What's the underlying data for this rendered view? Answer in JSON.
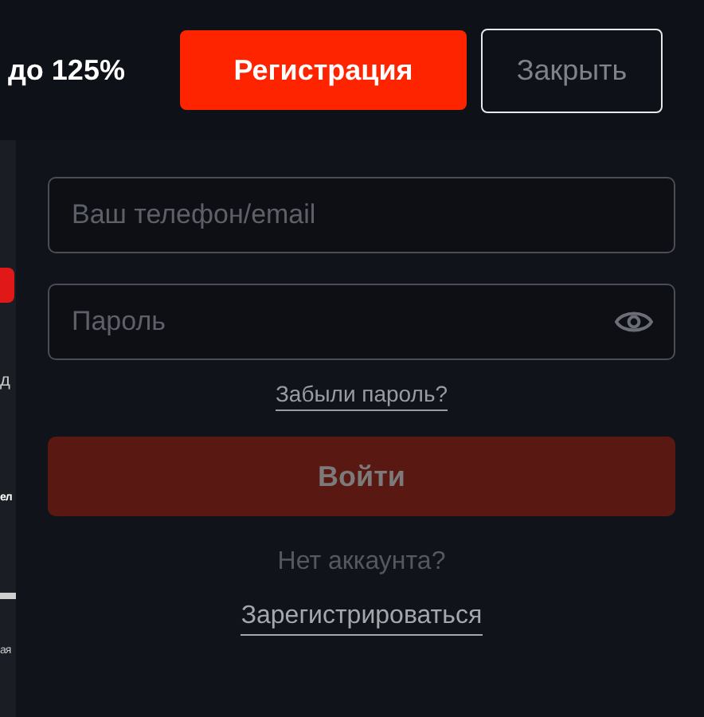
{
  "header": {
    "bonus_text": "до 125%",
    "register_button": "Регистрация",
    "close_button": "Закрыть"
  },
  "background_page": {
    "fragments": [
      "д",
      "ел",
      "ая"
    ]
  },
  "login_form": {
    "login_field": {
      "placeholder": "Ваш телефон/email"
    },
    "password_field": {
      "placeholder": "Пароль"
    },
    "forgot_link": "Забыли пароль?",
    "login_button": {
      "label": "Войти",
      "disabled": true
    },
    "no_account_text": "Нет аккаунта?",
    "signup_link": "Зарегистрироваться"
  }
}
